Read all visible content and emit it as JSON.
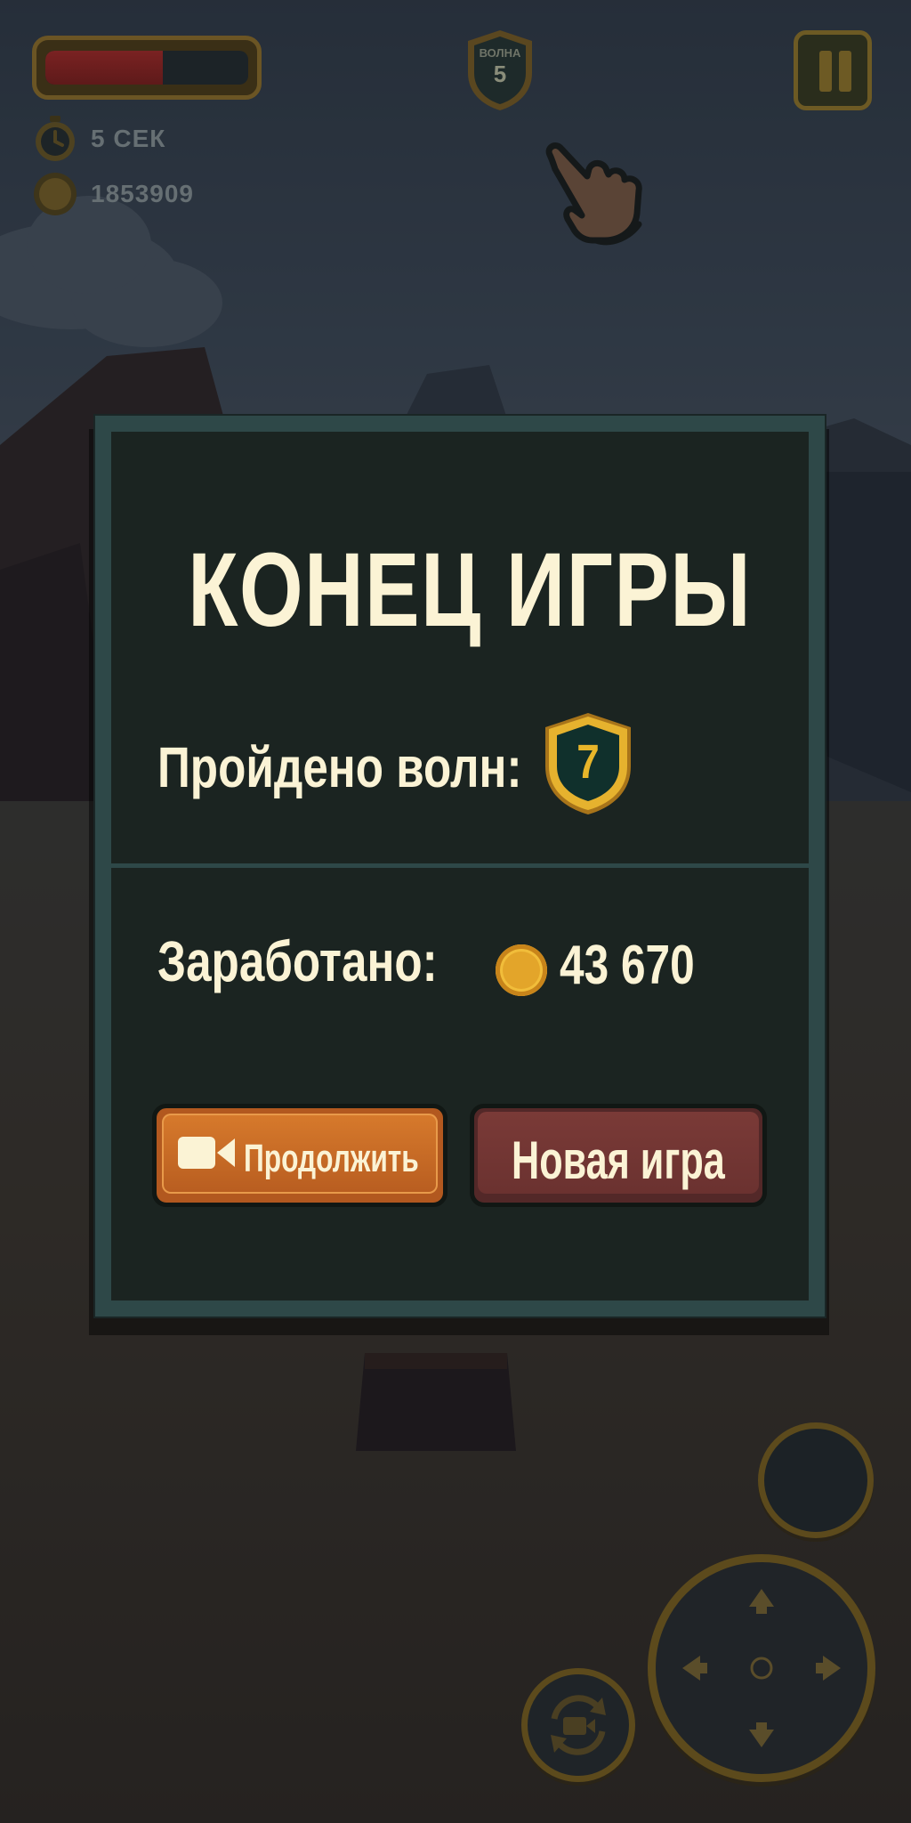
{
  "hud": {
    "health_fraction": 0.58,
    "wave": {
      "label": "ВОЛНА",
      "number": "5"
    },
    "timer_text": "5 СЕК",
    "coins_text": "1853909"
  },
  "modal": {
    "title": "КОНЕЦ ИГРЫ",
    "waves_label": "Пройдено волн:",
    "waves_value": "7",
    "earned_label": "Заработано:",
    "earned_value": "43 670",
    "continue_label": "Продолжить",
    "new_game_label": "Новая игра"
  },
  "colors": {
    "panel_border": "#2e4848",
    "panel_bg": "#1b2421",
    "text_cream": "#fbf3d5",
    "gold": "#e8b62a",
    "continue_orange": "#d77a2c",
    "new_game_red": "#7a3a37"
  },
  "icons": {
    "timer": "stopwatch-icon",
    "coins": "coin-icon",
    "pause": "pause-icon",
    "tutorial": "pointing-hand-icon",
    "continue": "video-camera-icon",
    "camera": "rotate-camera-icon"
  }
}
